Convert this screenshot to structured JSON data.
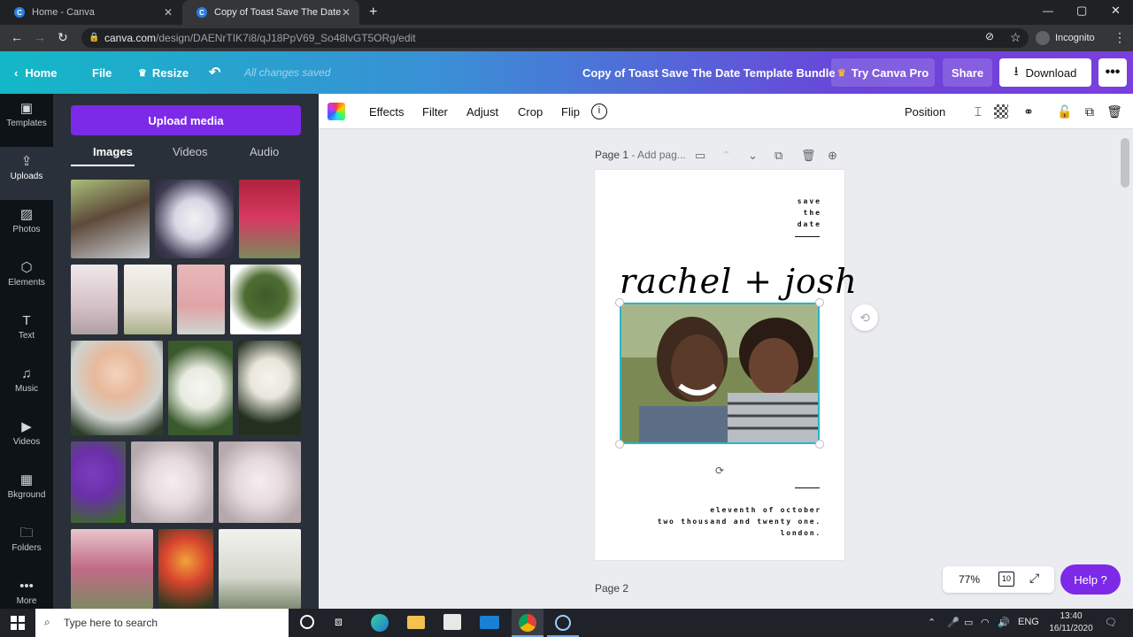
{
  "browser": {
    "tabs": [
      {
        "title": "Home - Canva",
        "active": false
      },
      {
        "title": "Copy of Toast Save The Date Ten",
        "active": true
      }
    ],
    "url_host": "canva.com",
    "url_path": "/design/DAENrTIK7i8/qJ18PpV69_So48lvGT5ORg/edit",
    "incognito_label": "Incognito"
  },
  "header": {
    "home": "Home",
    "file": "File",
    "resize": "Resize",
    "saved_status": "All changes saved",
    "doc_title": "Copy of Toast Save The Date Template Bundle",
    "try_pro": "Try Canva Pro",
    "share": "Share",
    "download": "Download",
    "more": "•••"
  },
  "leftnav": [
    {
      "label": "Templates",
      "icon": "templates-icon"
    },
    {
      "label": "Uploads",
      "icon": "upload-icon"
    },
    {
      "label": "Photos",
      "icon": "photos-icon"
    },
    {
      "label": "Elements",
      "icon": "elements-icon"
    },
    {
      "label": "Text",
      "icon": "text-icon"
    },
    {
      "label": "Music",
      "icon": "music-icon"
    },
    {
      "label": "Videos",
      "icon": "videos-icon"
    },
    {
      "label": "Bkground",
      "icon": "background-icon"
    },
    {
      "label": "Folders",
      "icon": "folders-icon"
    },
    {
      "label": "More",
      "icon": "more-icon"
    }
  ],
  "panel": {
    "upload_button": "Upload media",
    "tabs": [
      "Images",
      "Videos",
      "Audio"
    ],
    "collapse": "‹"
  },
  "toolbar": {
    "effects": "Effects",
    "filter": "Filter",
    "adjust": "Adjust",
    "crop": "Crop",
    "flip": "Flip",
    "position": "Position"
  },
  "canvas": {
    "page1_label": "Page 1",
    "page1_title_placeholder": "- Add pag...",
    "save_the_date": [
      "save",
      "the",
      "date"
    ],
    "names": "rachel + josh",
    "details": [
      "eleventh of october",
      "two thousand and twenty one.",
      "london."
    ],
    "page2_label": "Page 2"
  },
  "footer": {
    "zoom": "77%",
    "pages": "10",
    "help": "Help ?"
  },
  "taskbar": {
    "search_placeholder": "Type here to search",
    "lang": "ENG",
    "time": "13:40",
    "date": "16/11/2020"
  },
  "colors": {
    "accent_purple": "#7d2ae8",
    "selection_teal": "#2ab6c8",
    "panel_bg": "#293039",
    "nav_bg": "#0e1318"
  }
}
